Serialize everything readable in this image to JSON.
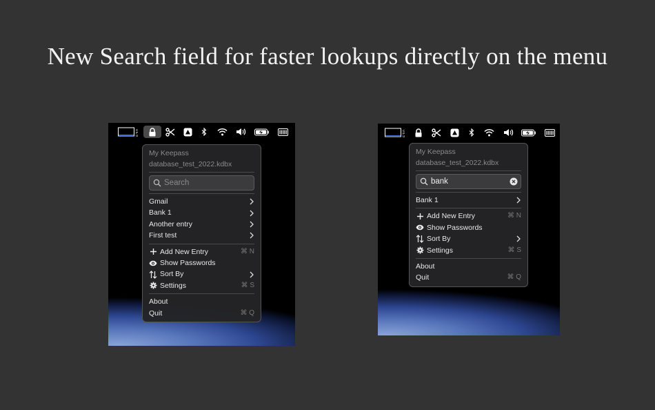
{
  "headline": "New Search field for faster lookups directly on the menu",
  "colors": {
    "background": "#333333",
    "menu": "#242426",
    "text": "#e8e8e8",
    "muted": "#8a8a8a"
  },
  "menubar_icons": [
    "cpu-meter-icon",
    "lock-icon",
    "scissors-icon",
    "cloud-drive-icon",
    "bluetooth-icon",
    "wifi-icon",
    "volume-icon",
    "battery-charging-icon",
    "memory-icon"
  ],
  "left_menu": {
    "vault_name": "My Keepass",
    "database_file": "database_test_2022.kdbx",
    "search_placeholder": "Search",
    "search_value": "",
    "entries": [
      {
        "label": "Gmail"
      },
      {
        "label": "Bank 1"
      },
      {
        "label": "Another entry"
      },
      {
        "label": "First test"
      }
    ],
    "actions": [
      {
        "label": "Add New Entry",
        "shortcut": "⌘ N",
        "icon": "plus-icon"
      },
      {
        "label": "Show Passwords",
        "shortcut": "",
        "icon": "eye-icon"
      },
      {
        "label": "Sort By",
        "shortcut": "",
        "icon": "sort-icon"
      },
      {
        "label": "Settings",
        "shortcut": "⌘ S",
        "icon": "gear-icon"
      }
    ],
    "about": "About",
    "quit": "Quit",
    "quit_shortcut": "⌘ Q"
  },
  "right_menu": {
    "vault_name": "My Keepass",
    "database_file": "database_test_2022.kdbx",
    "search_placeholder": "Search",
    "search_value": "bank",
    "entries": [
      {
        "label": "Bank 1"
      }
    ],
    "actions": [
      {
        "label": "Add New Entry",
        "shortcut": "⌘ N",
        "icon": "plus-icon"
      },
      {
        "label": "Show Passwords",
        "shortcut": "",
        "icon": "eye-icon"
      },
      {
        "label": "Sort By",
        "shortcut": "",
        "icon": "sort-icon"
      },
      {
        "label": "Settings",
        "shortcut": "⌘ S",
        "icon": "gear-icon"
      }
    ],
    "about": "About",
    "quit": "Quit",
    "quit_shortcut": "⌘ Q"
  }
}
